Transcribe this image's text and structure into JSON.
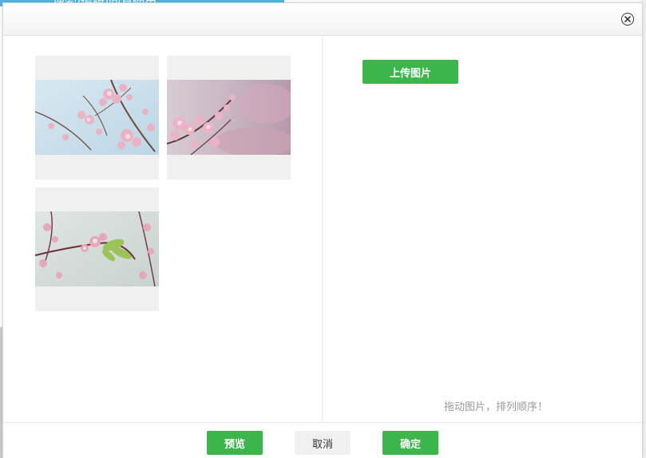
{
  "background": {
    "top_text": "搜索/编辑/回复使用"
  },
  "dialog": {
    "close_icon": "close-circle-icon",
    "images": [
      {
        "alt": "cherry-blossom-photo-1",
        "palette": [
          "#cfe3ee",
          "#e9b8c8",
          "#6f4a3a"
        ]
      },
      {
        "alt": "cherry-blossom-photo-2",
        "palette": [
          "#d9c8d2",
          "#e8a9bf",
          "#5c3a3a"
        ]
      },
      {
        "alt": "cherry-blossom-photo-3",
        "palette": [
          "#d4ddd9",
          "#e3a3b8",
          "#6b2d3a"
        ]
      }
    ],
    "upload_label": "上传图片",
    "hint": "拖动图片，排列顺序！",
    "footer": {
      "preview_label": "预览",
      "cancel_label": "取消",
      "ok_label": "确定"
    }
  },
  "colors": {
    "accent_green": "#3cb54a",
    "cancel_gray": "#f0f0f0",
    "thumb_bg": "#f0f0f0"
  }
}
